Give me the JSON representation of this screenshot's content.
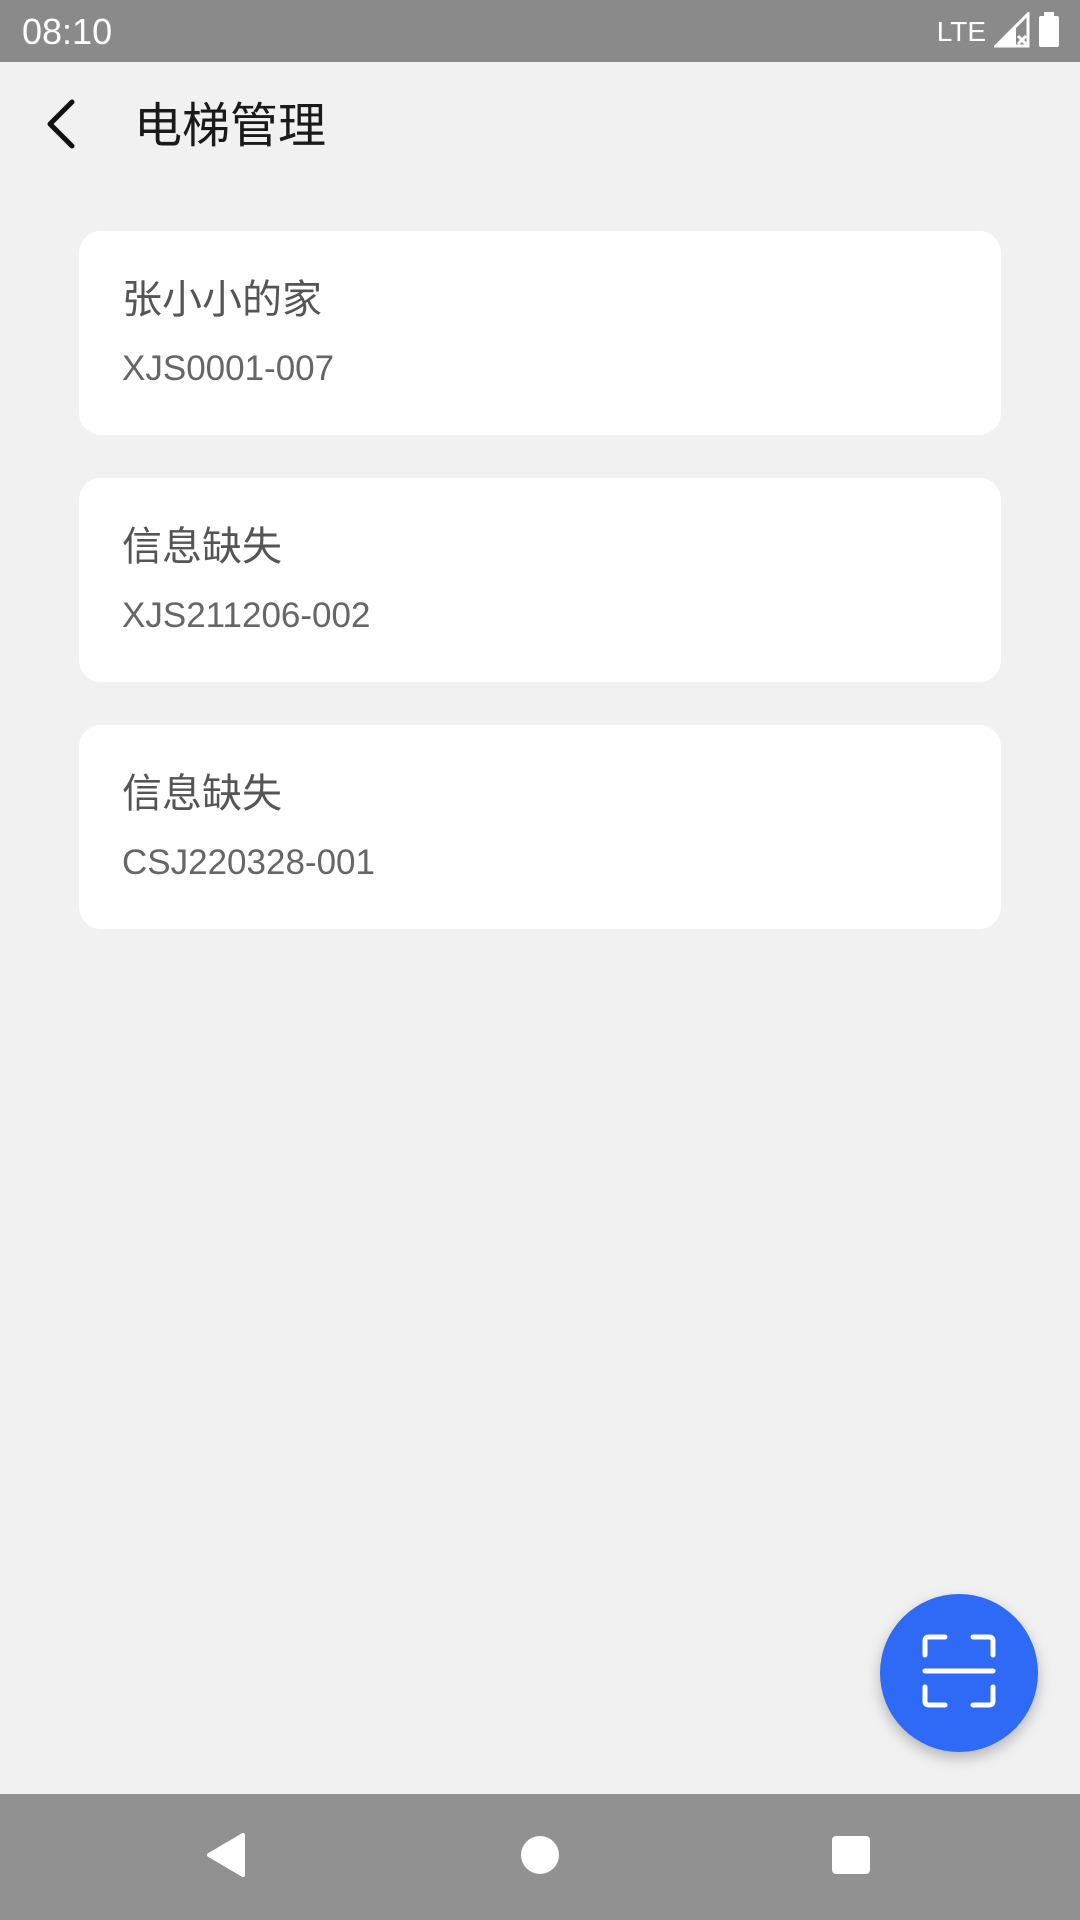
{
  "status_bar": {
    "time": "08:10",
    "network": "LTE"
  },
  "header": {
    "title": "电梯管理"
  },
  "elevators": [
    {
      "name": "张小小的家",
      "code": "XJS0001-007"
    },
    {
      "name": "信息缺失",
      "code": "XJS211206-002"
    },
    {
      "name": "信息缺失",
      "code": "CSJ220328-001"
    }
  ],
  "colors": {
    "accent": "#2e6af6",
    "background": "#f1f1f2",
    "card": "#ffffff"
  },
  "icons": {
    "back": "arrow-back-icon",
    "fab": "scan-icon",
    "nav_back": "nav-back-icon",
    "nav_home": "nav-home-icon",
    "nav_recents": "nav-recents-icon"
  }
}
